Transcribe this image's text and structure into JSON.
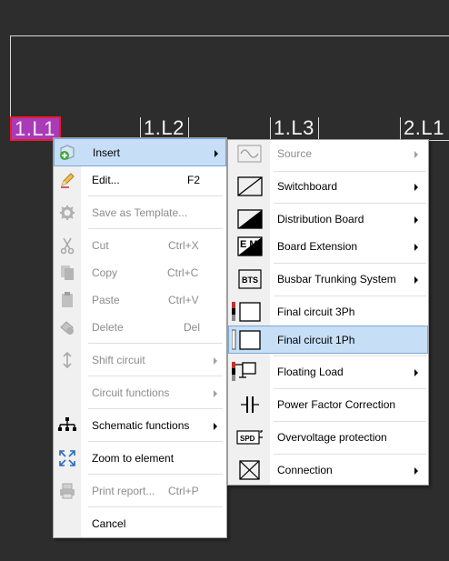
{
  "canvas": {
    "circuits": [
      "1.L1",
      "1.L2",
      "1.L3",
      "2.L1"
    ]
  },
  "context_menu": {
    "items": [
      {
        "label": "Insert",
        "shortcut": "",
        "submenu": true,
        "enabled": true,
        "highlighted": true,
        "icon": "insert-icon"
      },
      {
        "label": "Edit...",
        "shortcut": "F2",
        "submenu": false,
        "enabled": true,
        "icon": "edit-pencil-icon"
      },
      {
        "label": "Save as Template...",
        "shortcut": "",
        "submenu": false,
        "enabled": false,
        "icon": "gear-icon"
      },
      {
        "label": "Cut",
        "shortcut": "Ctrl+X",
        "submenu": false,
        "enabled": false,
        "icon": "scissors-icon"
      },
      {
        "label": "Copy",
        "shortcut": "Ctrl+C",
        "submenu": false,
        "enabled": false,
        "icon": "copy-icon"
      },
      {
        "label": "Paste",
        "shortcut": "Ctrl+V",
        "submenu": false,
        "enabled": false,
        "icon": "paste-icon"
      },
      {
        "label": "Delete",
        "shortcut": "Del",
        "submenu": false,
        "enabled": false,
        "icon": "delete-icon"
      },
      {
        "label": "Shift circuit",
        "shortcut": "",
        "submenu": true,
        "enabled": false,
        "icon": "shift-arrows-icon"
      },
      {
        "label": "Circuit functions",
        "shortcut": "",
        "submenu": true,
        "enabled": false,
        "icon": ""
      },
      {
        "label": "Schematic functions",
        "shortcut": "",
        "submenu": true,
        "enabled": true,
        "icon": "schematic-tree-icon"
      },
      {
        "label": "Zoom to element",
        "shortcut": "",
        "submenu": false,
        "enabled": true,
        "icon": "zoom-expand-icon"
      },
      {
        "label": "Print report...",
        "shortcut": "Ctrl+P",
        "submenu": false,
        "enabled": false,
        "icon": "printer-icon"
      },
      {
        "label": "Cancel",
        "shortcut": "",
        "submenu": false,
        "enabled": true,
        "icon": ""
      }
    ]
  },
  "insert_submenu": {
    "items": [
      {
        "label": "Source",
        "submenu": true,
        "enabled": false,
        "icon": "source-sine-icon"
      },
      {
        "label": "Switchboard",
        "submenu": true,
        "enabled": true,
        "icon": "switchboard-icon"
      },
      {
        "label": "Distribution Board",
        "submenu": true,
        "enabled": true,
        "icon": "distribution-board-icon"
      },
      {
        "label": "Board Extension",
        "submenu": true,
        "enabled": true,
        "icon": "board-extension-icon",
        "icon_text": "E M"
      },
      {
        "label": "Busbar Trunking System",
        "submenu": true,
        "enabled": true,
        "icon": "bts-icon",
        "icon_text": "BTS"
      },
      {
        "label": "Final circuit 3Ph",
        "submenu": false,
        "enabled": true,
        "icon": "final-circuit-3ph-icon"
      },
      {
        "label": "Final circuit 1Ph",
        "submenu": false,
        "enabled": true,
        "highlighted": true,
        "icon": "final-circuit-1ph-icon"
      },
      {
        "label": "Floating Load",
        "submenu": true,
        "enabled": true,
        "icon": "floating-load-icon"
      },
      {
        "label": "Power Factor Correction",
        "submenu": false,
        "enabled": true,
        "icon": "capacitor-icon"
      },
      {
        "label": "Overvoltage protection",
        "submenu": false,
        "enabled": true,
        "icon": "spd-icon",
        "icon_text": "SPD"
      },
      {
        "label": "Connection",
        "submenu": true,
        "enabled": true,
        "icon": "connection-box-icon"
      }
    ]
  },
  "colors": {
    "canvas_bg": "#2d2d2d",
    "selection_fill": "#a93ab8",
    "selection_border": "#e81c2c",
    "menu_highlight": "#c6def6"
  }
}
